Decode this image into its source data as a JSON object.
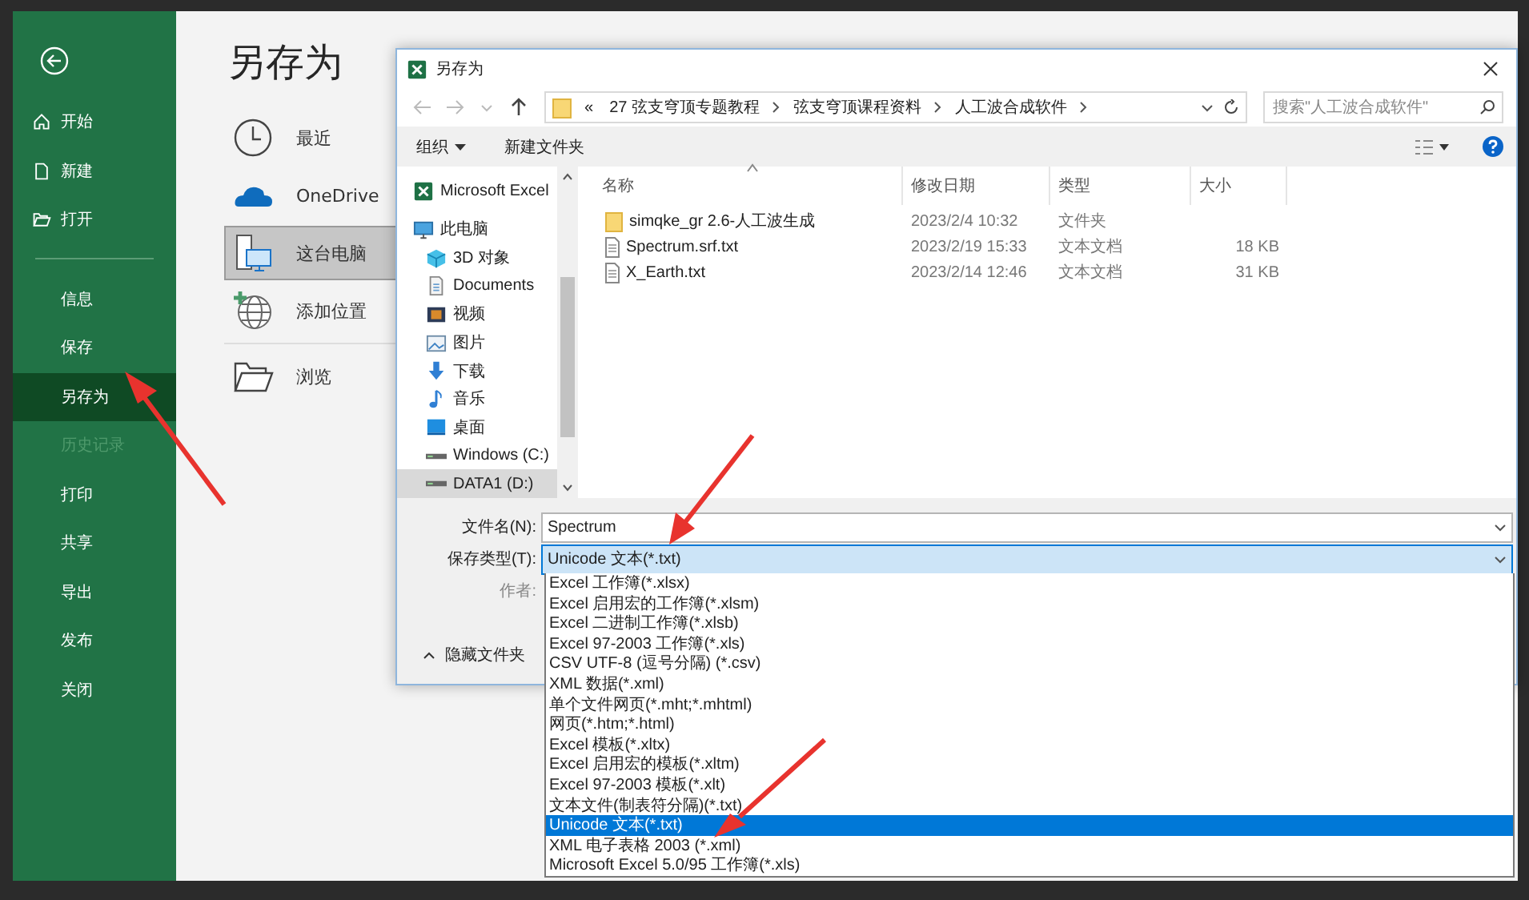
{
  "sidebar": {
    "items": [
      {
        "label": "开始",
        "kind": "home",
        "selected": false,
        "disabled": false
      },
      {
        "label": "新建",
        "kind": "new",
        "selected": false,
        "disabled": false
      },
      {
        "label": "打开",
        "kind": "open",
        "selected": false,
        "disabled": false
      },
      {
        "label": "信息",
        "kind": "plain",
        "selected": false,
        "disabled": false
      },
      {
        "label": "保存",
        "kind": "plain",
        "selected": false,
        "disabled": false
      },
      {
        "label": "另存为",
        "kind": "plain",
        "selected": true,
        "disabled": false
      },
      {
        "label": "历史记录",
        "kind": "plain",
        "selected": false,
        "disabled": true
      },
      {
        "label": "打印",
        "kind": "plain",
        "selected": false,
        "disabled": false
      },
      {
        "label": "共享",
        "kind": "plain",
        "selected": false,
        "disabled": false
      },
      {
        "label": "导出",
        "kind": "plain",
        "selected": false,
        "disabled": false
      },
      {
        "label": "发布",
        "kind": "plain",
        "selected": false,
        "disabled": false
      },
      {
        "label": "关闭",
        "kind": "plain",
        "selected": false,
        "disabled": false
      }
    ]
  },
  "backstage": {
    "title": "另存为",
    "locations": [
      {
        "label": "最近",
        "kind": "recent",
        "selected": false
      },
      {
        "label": "OneDrive",
        "kind": "cloud",
        "selected": false
      },
      {
        "label": "这台电脑",
        "kind": "pc",
        "selected": true
      },
      {
        "label": "添加位置",
        "kind": "add",
        "selected": false
      },
      {
        "label": "浏览",
        "kind": "browse",
        "selected": false
      }
    ]
  },
  "dialog": {
    "title": "另存为",
    "address_overflow": "«",
    "breadcrumb": [
      "27 弦支穹顶专题教程",
      "弦支穹顶课程资料",
      "人工波合成软件"
    ],
    "search": {
      "placeholder": "搜索\"人工波合成软件\""
    },
    "toolbar": {
      "organize": "组织",
      "new_folder": "新建文件夹"
    },
    "nav_tree": [
      {
        "label": "Microsoft Excel",
        "kind": "excel",
        "selected": false
      },
      {
        "label": "此电脑",
        "kind": "pc",
        "selected": false,
        "children": [
          {
            "label": "3D 对象",
            "kind": "cube",
            "selected": false
          },
          {
            "label": "Documents",
            "kind": "doc",
            "selected": false
          },
          {
            "label": "视频",
            "kind": "video",
            "selected": false
          },
          {
            "label": "图片",
            "kind": "picture",
            "selected": false
          },
          {
            "label": "下载",
            "kind": "download",
            "selected": false
          },
          {
            "label": "音乐",
            "kind": "music",
            "selected": false
          },
          {
            "label": "桌面",
            "kind": "desktop",
            "selected": false
          },
          {
            "label": "Windows (C:)",
            "kind": "drive",
            "selected": false
          },
          {
            "label": "DATA1 (D:)",
            "kind": "drive",
            "selected": true
          }
        ]
      }
    ],
    "columns": [
      "名称",
      "修改日期",
      "类型",
      "大小"
    ],
    "rows": [
      {
        "kind": "folder",
        "name": "simqke_gr 2.6-人工波生成",
        "date": "2023/2/4 10:32",
        "type": "文件夹"
      },
      {
        "kind": "file",
        "name": "Spectrum.srf.txt",
        "date": "2023/2/19 15:33",
        "type": "文本文档",
        "size": "18 KB"
      },
      {
        "kind": "file",
        "name": "X_Earth.txt",
        "date": "2023/2/14 12:46",
        "type": "文本文档",
        "size": "31 KB"
      }
    ],
    "filename": {
      "label": "文件名(N):",
      "value": "Spectrum"
    },
    "file_type": {
      "label": "保存类型(T):",
      "value": "Unicode 文本(*.txt)",
      "expanded": true,
      "options": [
        {
          "label": "Excel 工作簿(*.xlsx)",
          "selected": false
        },
        {
          "label": "Excel 启用宏的工作簿(*.xlsm)",
          "selected": false
        },
        {
          "label": "Excel 二进制工作簿(*.xlsb)",
          "selected": false
        },
        {
          "label": "Excel 97-2003 工作簿(*.xls)",
          "selected": false
        },
        {
          "label": "CSV UTF-8 (逗号分隔) (*.csv)",
          "selected": false
        },
        {
          "label": "XML 数据(*.xml)",
          "selected": false
        },
        {
          "label": "单个文件网页(*.mht;*.mhtml)",
          "selected": false
        },
        {
          "label": "网页(*.htm;*.html)",
          "selected": false
        },
        {
          "label": "Excel 模板(*.xltx)",
          "selected": false
        },
        {
          "label": "Excel 启用宏的模板(*.xltm)",
          "selected": false
        },
        {
          "label": "Excel 97-2003 模板(*.xlt)",
          "selected": false
        },
        {
          "label": "文本文件(制表符分隔)(*.txt)",
          "selected": false
        },
        {
          "label": "Unicode 文本(*.txt)",
          "selected": true
        },
        {
          "label": "XML 电子表格 2003 (*.xml)",
          "selected": false
        },
        {
          "label": "Microsoft Excel 5.0/95 工作簿(*.xls)",
          "selected": false
        }
      ]
    },
    "author_label": "作者:",
    "hide_folders": "隐藏文件夹"
  }
}
